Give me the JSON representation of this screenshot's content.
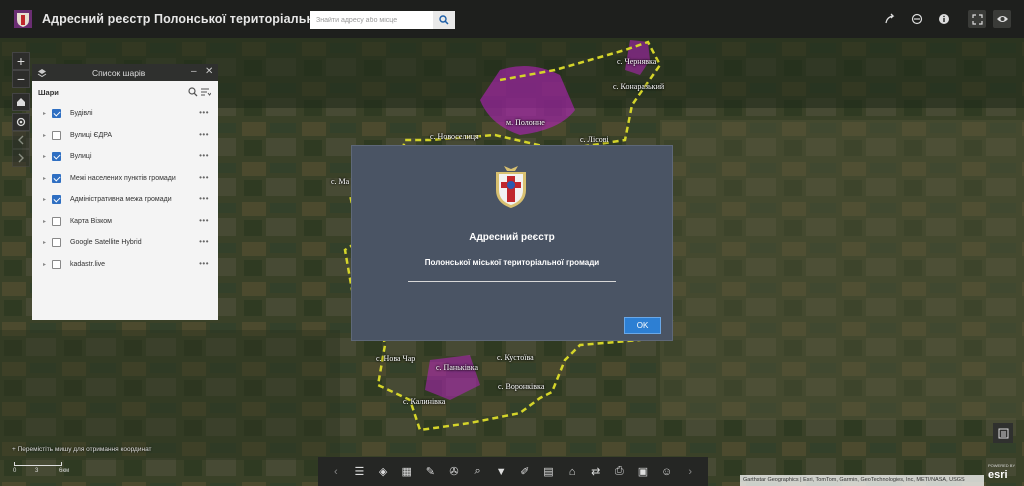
{
  "header": {
    "title": "Адресний реєстр Полонської територіальної громади",
    "search_placeholder": "Знайти адресу або місце",
    "icons": [
      "share-icon",
      "layer-view-icon",
      "info-icon",
      "fullscreen-icon",
      "eye-icon"
    ]
  },
  "map": {
    "labels": [
      "с. Чернявка",
      "с. Конаразький",
      "м. Полонне",
      "с. Новоселиця",
      "с. Лісові",
      "с. Ма",
      "с. Кустоїва",
      "с. Паньківка",
      "с. Нова Чар",
      "с. Воронківка",
      "с. Калинівка"
    ],
    "zoom_in": "+",
    "zoom_out": "−"
  },
  "layer_panel": {
    "title": "Список шарів",
    "section": "Шари",
    "layers": [
      {
        "label": "Будівлі",
        "checked": true
      },
      {
        "label": "Вулиці ЄДРА",
        "checked": false
      },
      {
        "label": "Вулиці",
        "checked": true
      },
      {
        "label": "Межі населених пунктів громади",
        "checked": true
      },
      {
        "label": "Адміністративна межа громади",
        "checked": true
      },
      {
        "label": "Карта Візком",
        "checked": false
      },
      {
        "label": "Google Satellite Hybrid",
        "checked": false
      },
      {
        "label": "kadastr.live",
        "checked": false
      }
    ]
  },
  "dialog": {
    "title": "Адресний реєстр",
    "subtitle": "Полонської міської територіальної громади",
    "ok_label": "OK"
  },
  "footer": {
    "coordinate_hint": "Перемістіть мишу для отримання координат",
    "scale_labels": [
      "0",
      "3",
      "6км"
    ],
    "attribution": "Garthstar Geographics | Esri, TomTom, Garmin, GeoTechnologies, Inc, METI/NASA, USGS",
    "esri": "esri",
    "powered_by": "POWERED BY"
  },
  "toolbar": {
    "icons": [
      "list-icon",
      "layers-icon",
      "basemap-grid-icon",
      "draw-pencil-icon",
      "analysis-icon",
      "query-icon",
      "filter-icon",
      "edit-icon",
      "report-icon",
      "home-icon",
      "swipe-icon",
      "print-icon",
      "bookmark-icon",
      "smile-icon"
    ]
  },
  "colors": {
    "header_bg": "#1e1f1d",
    "dialog_bg": "#4a5464",
    "ok_button": "#2d7fd3",
    "boundary": "#d4d42a",
    "settlement": "#c01fc9"
  }
}
